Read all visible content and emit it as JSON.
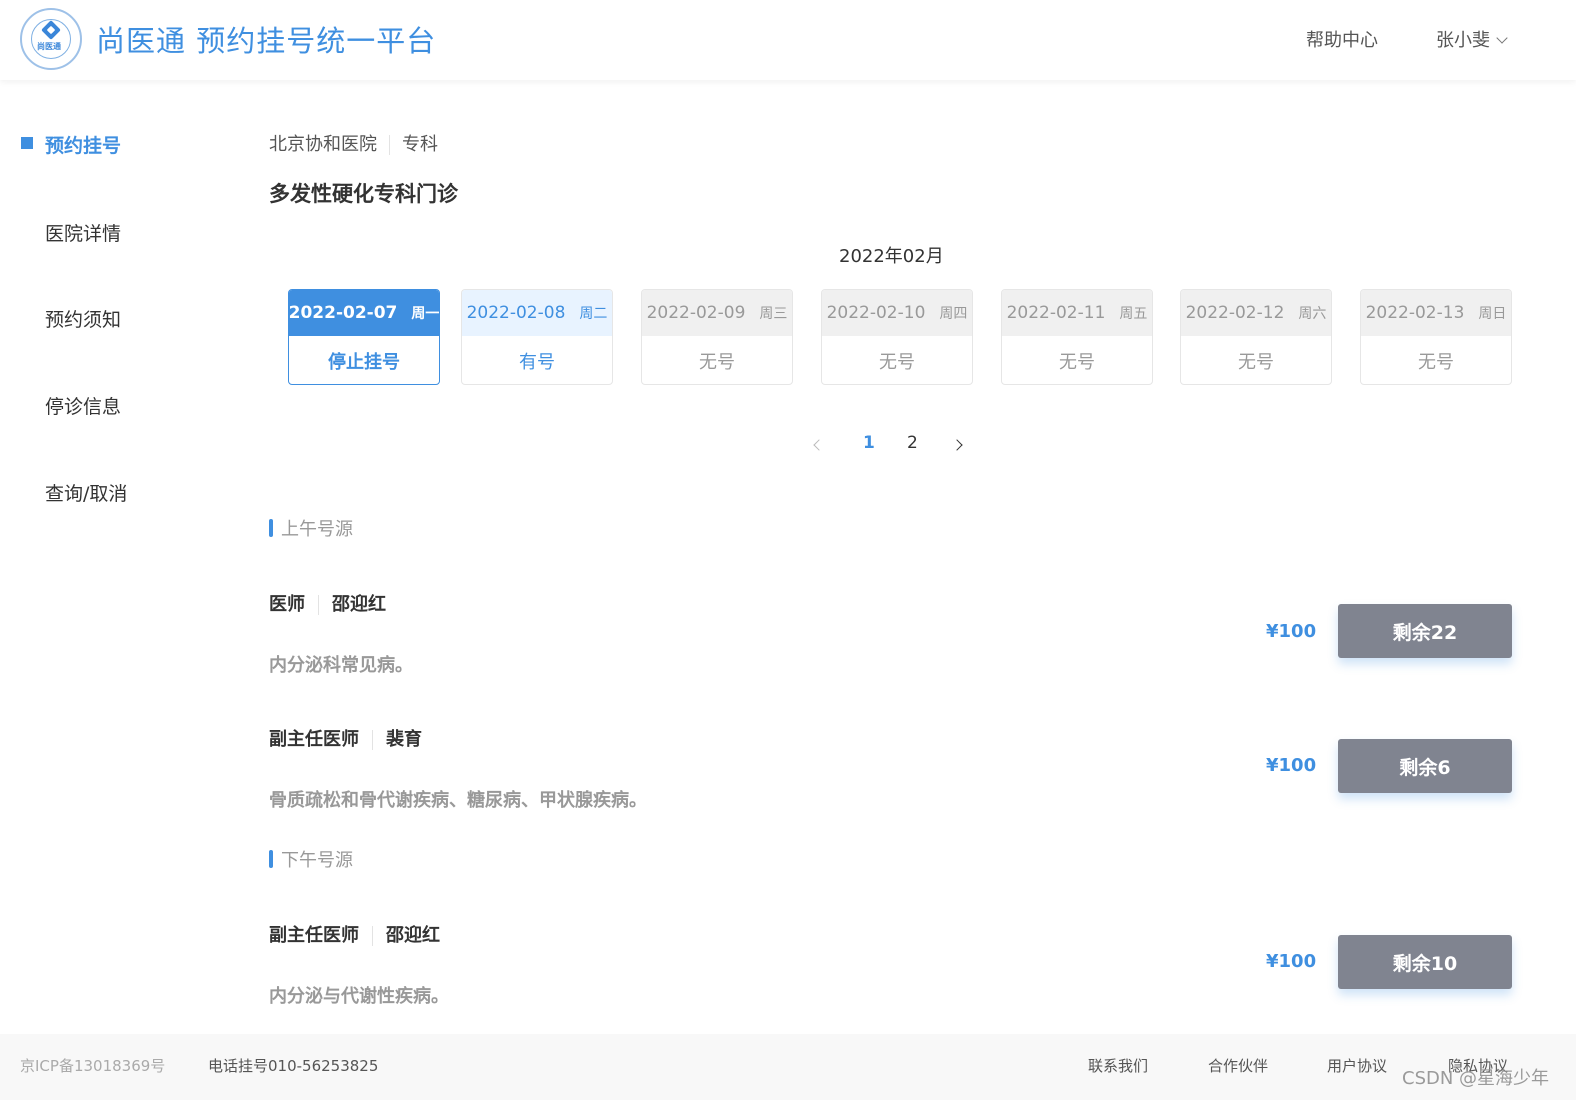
{
  "header": {
    "logo_text": "尚医通",
    "brand": "尚医通 预约挂号统一平台",
    "help": "帮助中心",
    "user": "张小斐"
  },
  "sidebar": {
    "items": [
      {
        "label": "预约挂号",
        "active": true
      },
      {
        "label": "医院详情",
        "active": false
      },
      {
        "label": "预约须知",
        "active": false
      },
      {
        "label": "停诊信息",
        "active": false
      },
      {
        "label": "查询/取消",
        "active": false
      }
    ]
  },
  "breadcrumb": {
    "hospital": "北京协和医院",
    "category": "专科"
  },
  "department_title": "多发性硬化专科门诊",
  "month_label": "2022年02月",
  "dates": [
    {
      "date": "2022-02-07",
      "weekday": "周一",
      "status": "停止挂号",
      "state": "selected"
    },
    {
      "date": "2022-02-08",
      "weekday": "周二",
      "status": "有号",
      "state": "available"
    },
    {
      "date": "2022-02-09",
      "weekday": "周三",
      "status": "无号",
      "state": "none"
    },
    {
      "date": "2022-02-10",
      "weekday": "周四",
      "status": "无号",
      "state": "none"
    },
    {
      "date": "2022-02-11",
      "weekday": "周五",
      "status": "无号",
      "state": "none"
    },
    {
      "date": "2022-02-12",
      "weekday": "周六",
      "status": "无号",
      "state": "none"
    },
    {
      "date": "2022-02-13",
      "weekday": "周日",
      "status": "无号",
      "state": "none"
    }
  ],
  "pagination": {
    "pages": [
      "1",
      "2"
    ],
    "current": "1"
  },
  "morning": {
    "label": "上午号源",
    "doctors": [
      {
        "title": "医师",
        "name": "邵迎红",
        "desc": "内分泌科常见病。",
        "price": "¥100",
        "remain": "剩余22"
      },
      {
        "title": "副主任医师",
        "name": "裴育",
        "desc": "骨质疏松和骨代谢疾病、糖尿病、甲状腺疾病。",
        "price": "¥100",
        "remain": "剩余6"
      }
    ]
  },
  "afternoon": {
    "label": "下午号源",
    "doctors": [
      {
        "title": "副主任医师",
        "name": "邵迎红",
        "desc": "内分泌与代谢性疾病。",
        "price": "¥100",
        "remain": "剩余10"
      }
    ]
  },
  "footer": {
    "icp": "京ICP备13018369号",
    "phone": "电话挂号010-56253825",
    "links": [
      "联系我们",
      "合作伙伴",
      "用户协议",
      "隐私协议"
    ]
  },
  "watermark": "CSDN @星海少年",
  "colors": {
    "accent": "#3f8fe0",
    "remain_button": "#808490",
    "selected_card": "#3f8fe0",
    "available_card_bg": "#e8f3ff"
  }
}
